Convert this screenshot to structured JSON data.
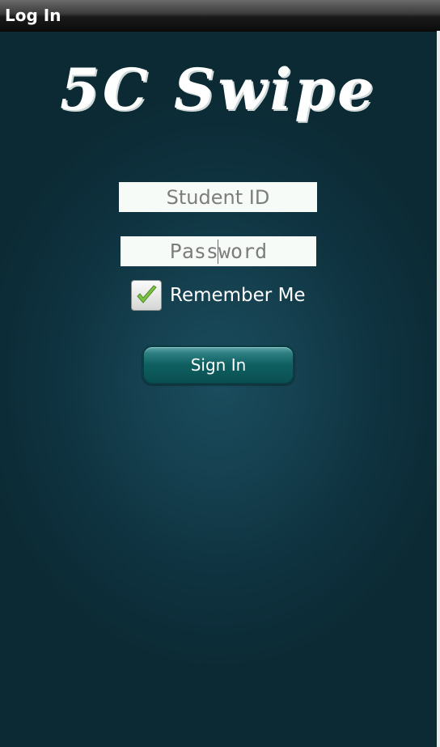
{
  "window": {
    "title": "Log In"
  },
  "app": {
    "logo_text": "5C Swipe"
  },
  "form": {
    "student_id": {
      "value": "",
      "placeholder": "Student ID"
    },
    "password": {
      "value": "",
      "placeholder": "Password"
    },
    "remember": {
      "label": "Remember Me",
      "checked": true
    },
    "submit_label": "Sign In"
  },
  "colors": {
    "background": "#0f3340",
    "accent_button": "#0f5f60",
    "check_mark": "#7cc242"
  },
  "icons": {
    "checkbox": "check-icon"
  }
}
